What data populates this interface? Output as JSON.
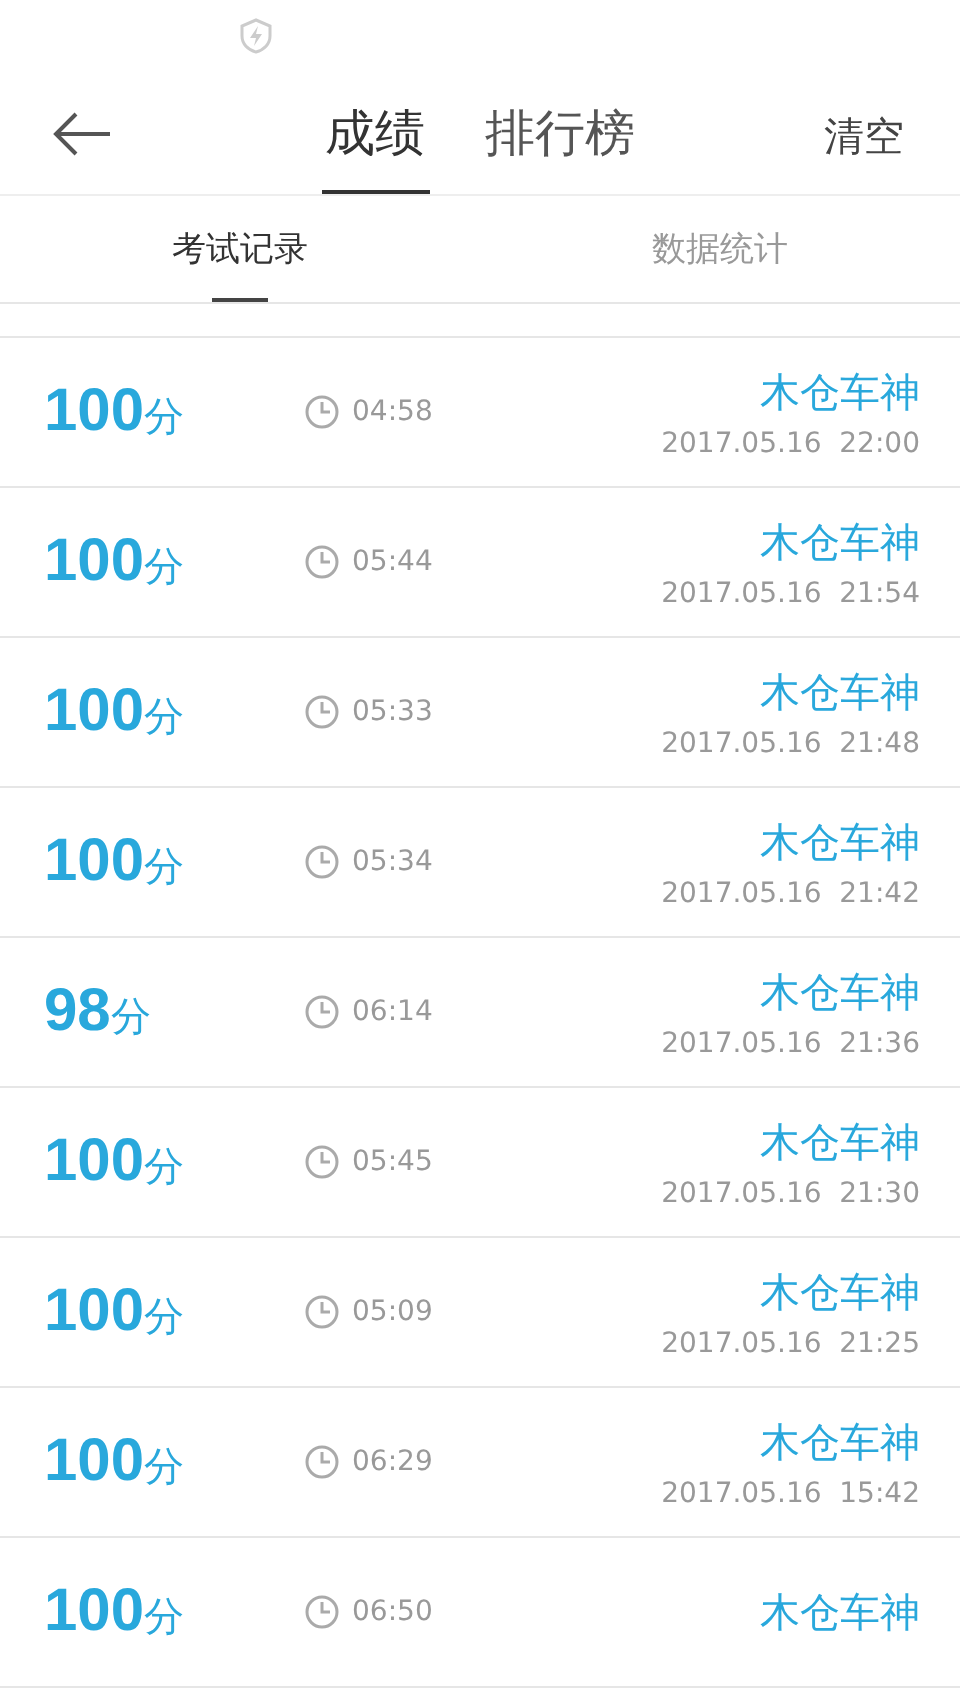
{
  "tabs": [
    {
      "label": "成绩",
      "selected": true
    },
    {
      "label": "排行榜",
      "selected": false
    }
  ],
  "clear_button": "清空",
  "subtabs": [
    {
      "label": "考试记录",
      "selected": true
    },
    {
      "label": "数据统计",
      "selected": false
    }
  ],
  "records": [
    {
      "score": "100",
      "unit": "分",
      "time": "04:58",
      "name": "木仓车神",
      "date": "2017.05.16  22:00"
    },
    {
      "score": "100",
      "unit": "分",
      "time": "05:44",
      "name": "木仓车神",
      "date": "2017.05.16  21:54"
    },
    {
      "score": "100",
      "unit": "分",
      "time": "05:33",
      "name": "木仓车神",
      "date": "2017.05.16  21:48"
    },
    {
      "score": "100",
      "unit": "分",
      "time": "05:34",
      "name": "木仓车神",
      "date": "2017.05.16  21:42"
    },
    {
      "score": "98",
      "unit": "分",
      "time": "06:14",
      "name": "木仓车神",
      "date": "2017.05.16  21:36"
    },
    {
      "score": "100",
      "unit": "分",
      "time": "05:45",
      "name": "木仓车神",
      "date": "2017.05.16  21:30"
    },
    {
      "score": "100",
      "unit": "分",
      "time": "05:09",
      "name": "木仓车神",
      "date": "2017.05.16  21:25"
    },
    {
      "score": "100",
      "unit": "分",
      "time": "06:29",
      "name": "木仓车神",
      "date": "2017.05.16  15:42"
    },
    {
      "score": "100",
      "unit": "分",
      "time": "06:50",
      "name": "木仓车神"
    }
  ]
}
